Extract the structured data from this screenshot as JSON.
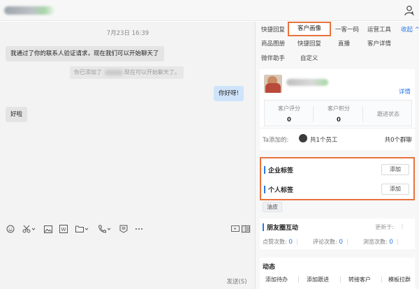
{
  "chat": {
    "timestamp": "7月23日 16:39",
    "messages": [
      {
        "text": "我通过了你的联系人验证请求，现在我们可以开始聊天了"
      },
      {
        "text": "你好呀!"
      },
      {
        "text": "好啦"
      }
    ],
    "system_notice": {
      "prefix": "你已添加了",
      "suffix": "现在可以开始聊天了。"
    },
    "send_label": "发送(S)",
    "toolbar_icons": [
      "emoji-icon",
      "scissors-icon",
      "image-icon",
      "word-doc-icon",
      "folder-icon",
      "phone-icon",
      "save-icon",
      "more-icon",
      "screen-icon",
      "sidebar-toggle-icon"
    ]
  },
  "panel": {
    "tabs_row1": [
      {
        "label": "快捷回复"
      },
      {
        "label": "客户画像",
        "active": true
      },
      {
        "label": "一客一码"
      },
      {
        "label": "运营工具"
      }
    ],
    "collapse_label": "收起",
    "tabs_row2": [
      "商品图册",
      "快捷回复",
      "直播",
      "客户详情"
    ],
    "tabs_row3": [
      "微伴助手",
      "自定义"
    ],
    "profile": {
      "detail_label": "详情",
      "stats": [
        {
          "label": "客户评分",
          "value": "0"
        },
        {
          "label": "客户积分",
          "value": "0"
        }
      ],
      "follow_status_label": "跟进状态",
      "added_by_label": "Ta添加的:",
      "staff_count": "共1个员工",
      "group_count": "共0个群聊"
    },
    "tags": {
      "enterprise_label": "企业标签",
      "personal_label": "个人标签",
      "add_label": "添加",
      "chip": "油皮"
    },
    "moments": {
      "title": "朋友圈互动",
      "update_label": "更新于:",
      "stats": [
        {
          "label": "点赞次数:",
          "value": "0"
        },
        {
          "label": "评论次数:",
          "value": "0"
        },
        {
          "label": "浏览次数:",
          "value": "0"
        }
      ]
    },
    "activity": {
      "title": "动态",
      "buttons": [
        "添加待办",
        "添加跟进",
        "转接客户",
        "模板拉群"
      ]
    }
  },
  "colors": {
    "accent": "#2b78e4",
    "highlight": "#e7733c",
    "outgoing_bubble": "#cfe4fb"
  }
}
